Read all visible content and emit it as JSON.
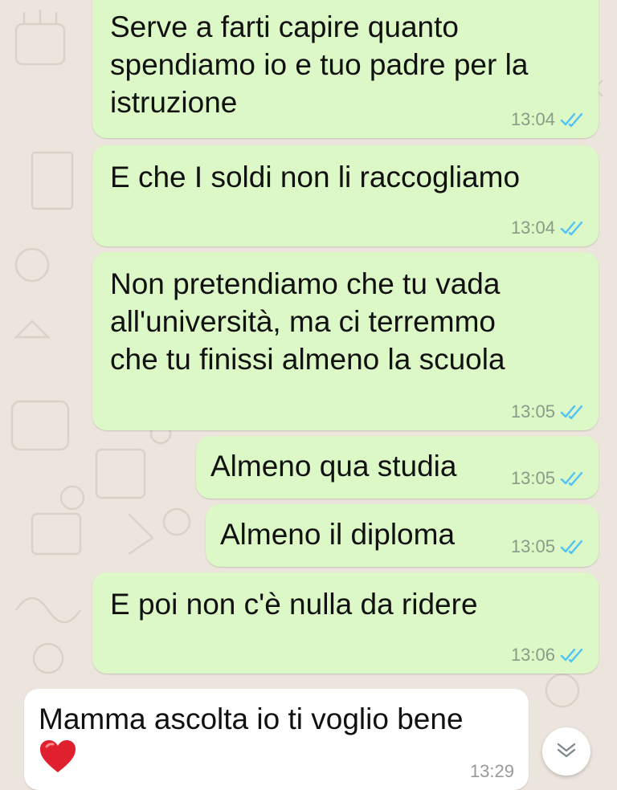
{
  "messages": [
    {
      "text": "Serve a farti capire quanto\nspendiamo io e tuo padre per la\nistruzione",
      "time": "13:04",
      "status": "read"
    },
    {
      "text": "E che I soldi non li raccogliamo",
      "time": "13:04",
      "status": "read"
    },
    {
      "text": "Non pretendiamo che tu vada\nall'università, ma ci terremmo\nche tu finissi almeno la scuola",
      "time": "13:05",
      "status": "read"
    },
    {
      "text": "Almeno qua studia",
      "time": "13:05",
      "status": "read"
    },
    {
      "text": "Almeno il diploma",
      "time": "13:05",
      "status": "read"
    },
    {
      "text": "E poi non c'è nulla da ridere",
      "time": "13:06",
      "status": "read"
    },
    {
      "text": "Mamma ascolta io ti voglio bene",
      "time": "13:29",
      "emoji": "red-heart"
    }
  ],
  "colors": {
    "outgoing_bubble": "#dcf8c6",
    "incoming_bubble": "#ffffff",
    "chat_background": "#ece5dd",
    "read_ticks": "#4fc3f7",
    "heart": "#e0202e"
  },
  "icons": [
    "double-check-icon",
    "heart-icon",
    "chevron-down-icon"
  ]
}
